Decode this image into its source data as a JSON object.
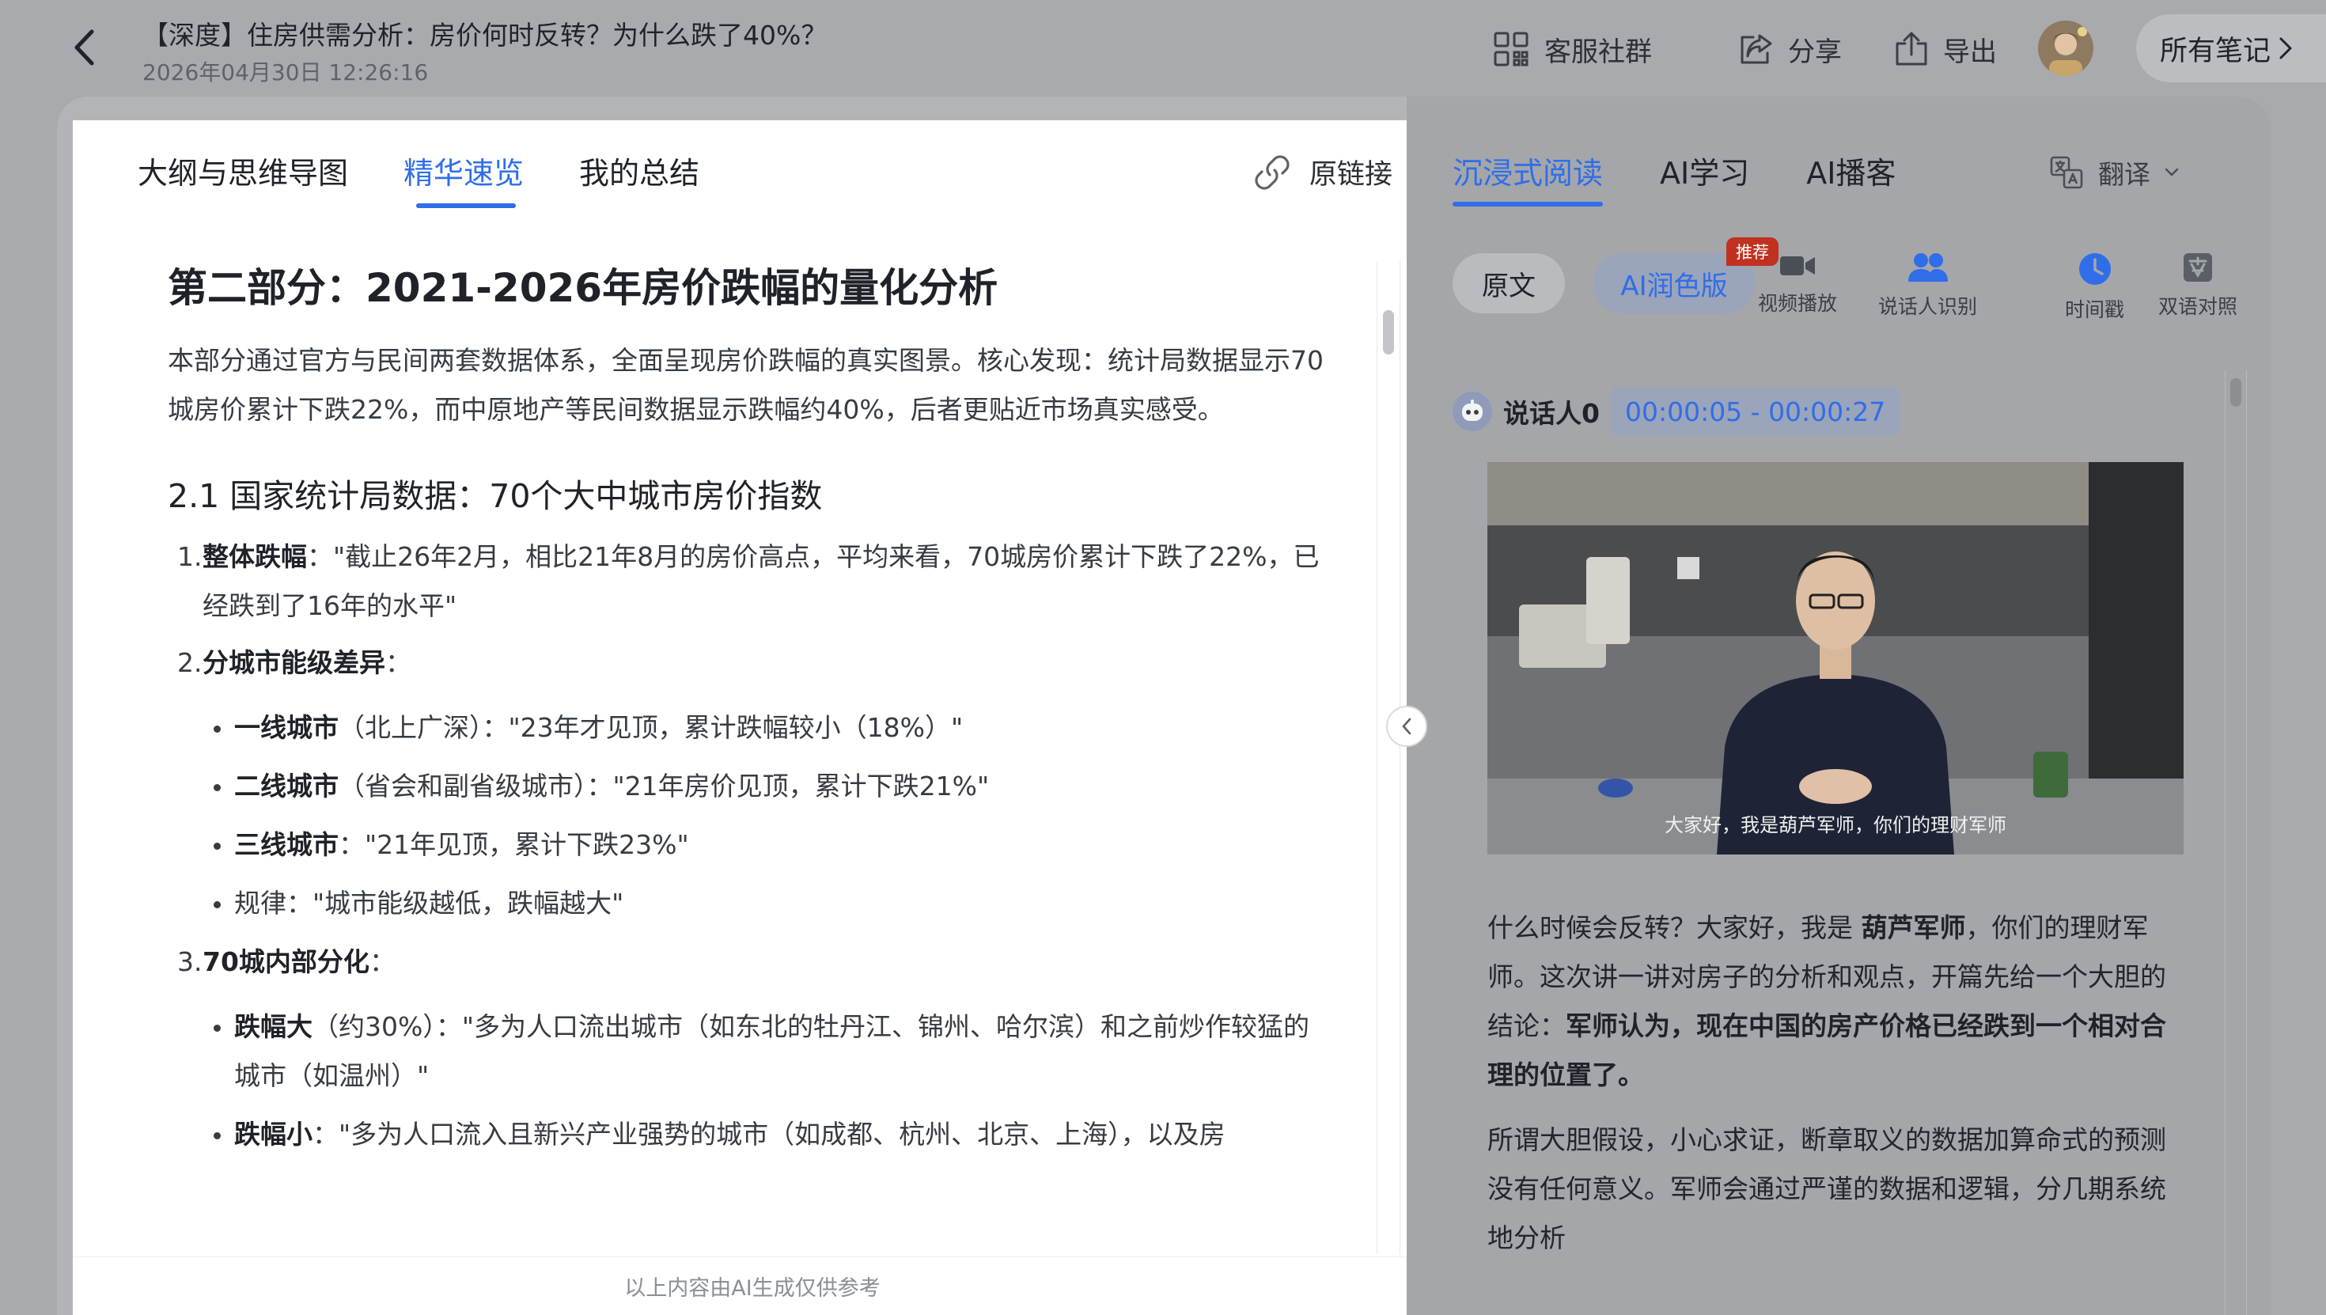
{
  "header": {
    "title": "【深度】住房供需分析：房价何时反转？为什么跌了40%？",
    "datetime": "2026年04月30日 12:26:16",
    "actions": {
      "community": "客服社群",
      "share": "分享",
      "export": "导出",
      "all_notes": "所有笔记"
    }
  },
  "left_panel": {
    "tabs": [
      "大纲与思维导图",
      "精华速览",
      "我的总结"
    ],
    "active_tab": "精华速览",
    "original_link": "原链接",
    "footer_note": "以上内容由AI生成仅供参考",
    "article": {
      "h2": "第二部分：2021-2026年房价跌幅的量化分析",
      "intro": "本部分通过官方与民间两套数据体系，全面呈现房价跌幅的真实图景。核心发现：统计局数据显示70城房价累计下跌22%，而中原地产等民间数据显示跌幅约40%，后者更贴近市场真实感受。",
      "h3": "2.1 国家统计局数据：70个大中城市房价指数",
      "items": [
        {
          "num": "1.",
          "label": "整体跌幅",
          "text": "：\"截止26年2月，相比21年8月的房价高点，平均来看，70城房价累计下跌了22%，已经跌到了16年的水平\""
        },
        {
          "num": "2.",
          "label": "分城市能级差异",
          "text": "：",
          "sub": [
            {
              "label": "一线城市",
              "text": "（北上广深）：\"23年才见顶，累计跌幅较小（18%）\""
            },
            {
              "label": "二线城市",
              "text": "（省会和副省级城市）：\"21年房价见顶，累计下跌21%\""
            },
            {
              "label": "三线城市",
              "text": "：\"21年见顶，累计下跌23%\""
            },
            {
              "label": "",
              "text": "规律：\"城市能级越低，跌幅越大\""
            }
          ]
        },
        {
          "num": "3.",
          "label": "70城内部分化",
          "text": "：",
          "sub": [
            {
              "label": "跌幅大",
              "text": "（约30%）：\"多为人口流出城市（如东北的牡丹江、锦州、哈尔滨）和之前炒作较猛的城市（如温州）\""
            },
            {
              "label": "跌幅小",
              "text": "：\"多为人口流入且新兴产业强势的城市（如成都、杭州、北京、上海），以及房"
            }
          ]
        }
      ]
    }
  },
  "right_panel": {
    "tabs": [
      "沉浸式阅读",
      "AI学习",
      "AI播客"
    ],
    "active_tab": "沉浸式阅读",
    "translate": "翻译",
    "modes": {
      "original": "原文",
      "ai_polish": "AI润色版",
      "badge": "推荐"
    },
    "tools": [
      "视频播放",
      "说话人识别",
      "时间戳",
      "双语对照"
    ],
    "speaker": {
      "name": "说话人0",
      "time_range": "00:00:05 - 00:00:27"
    },
    "video_subtitle": "大家好，我是葫芦军师，你们的理财军师",
    "transcript": {
      "p1": {
        "a": "什么时候会反转？大家好，我是 ",
        "b": "葫芦军师",
        "c": "，你们的理财军师。这次讲一讲对房子的分析和观点，开篇先给一个大胆的结论：",
        "d": "军师认为，现在中国的房产价格已经跌到一个相对合理的位置了。"
      },
      "p2": "所谓大胆假设，小心求证，断章取义的数据加算命式的预测没有任何意义。军师会通过严谨的数据和逻辑，分几期系统地分析"
    }
  },
  "colors": {
    "accent": "#2f6ee8",
    "badge": "#c0311f",
    "overlay": "#a8aaae"
  }
}
